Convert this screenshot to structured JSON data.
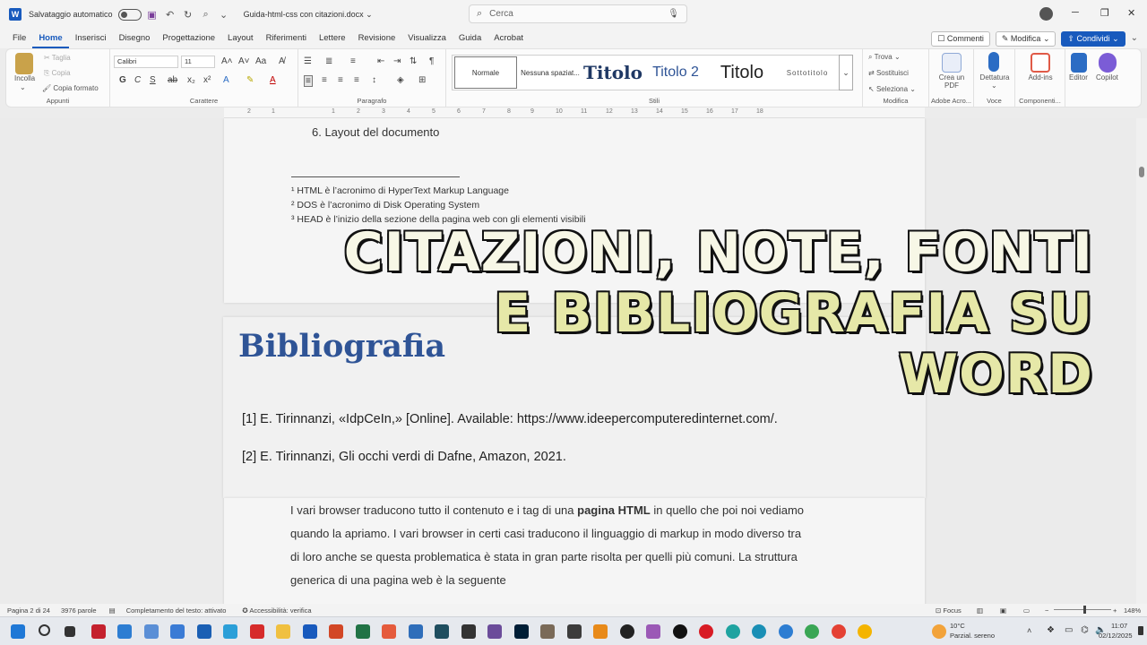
{
  "titlebar": {
    "app_logo": "W",
    "autosave_label": "Salvataggio automatico",
    "doc_title": "Guida-html-css con citazioni.docx",
    "search_placeholder": "Cerca"
  },
  "tabs": [
    "File",
    "Home",
    "Inserisci",
    "Disegno",
    "Progettazione",
    "Layout",
    "Riferimenti",
    "Lettere",
    "Revisione",
    "Visualizza",
    "Guida",
    "Acrobat"
  ],
  "tab_active": "Home",
  "top_buttons": {
    "comments": "Commenti",
    "edit": "Modifica",
    "share": "Condividi"
  },
  "ribbon": {
    "clipboard": {
      "paste": "Incolla",
      "cut": "Taglia",
      "copy": "Copia",
      "format_painter": "Copia formato",
      "label": "Appunti"
    },
    "font": {
      "name": "Calibri",
      "size": "11",
      "label": "Carattere"
    },
    "paragraph": {
      "label": "Paragrafo"
    },
    "styles": {
      "items": [
        "Normale",
        "Nessuna spaziat...",
        "Titolo",
        "Titolo 2",
        "Titolo",
        "Sottotitolo"
      ],
      "label": "Stili"
    },
    "editing": {
      "find": "Trova",
      "replace": "Sostituisci",
      "select": "Seleziona",
      "label": "Modifica"
    },
    "acrobat": {
      "create_pdf": "Crea un PDF",
      "label": "Adobe Acro..."
    },
    "voice": {
      "dictate": "Dettatura",
      "label": "Voce"
    },
    "addins": {
      "addins": "Add-ins",
      "label": "Componenti..."
    },
    "editor": "Editor",
    "copilot": "Copilot"
  },
  "ruler_numbers": [
    "2",
    "1",
    "1",
    "2",
    "3",
    "4",
    "5",
    "6",
    "7",
    "8",
    "9",
    "10",
    "11",
    "12",
    "13",
    "14",
    "15",
    "16",
    "17",
    "18"
  ],
  "document": {
    "list_item": "6.   Layout del documento",
    "footnotes": [
      "¹ HTML è l’acronimo di HyperText Markup Language",
      "² DOS è l’acronimo di Disk Operating System",
      "³ HEAD è l’inizio della sezione della pagina web con gli elementi visibili"
    ],
    "biblio_heading": "Bibliografia",
    "bib_entries": [
      "[1] E. Tirinnanzi, «IdpCeIn,» [Online]. Available: https://www.ideepercomputeredinternet.com/.",
      "[2] E. Tirinnanzi, Gli occhi verdi di Dafne, Amazon, 2021."
    ],
    "body_line1_a": "I vari browser traducono tutto il contenuto e i tag di una ",
    "body_line1_b": "pagina HTML",
    "body_line1_c": " in quello che poi noi vediamo",
    "body_lines": [
      "quando la apriamo. I vari browser in certi casi traducono il linguaggio di markup in modo diverso tra",
      "di loro anche se questa problematica è stata in gran parte risolta per quelli più comuni.  La struttura",
      "generica di una pagina web è la seguente"
    ]
  },
  "overlay": {
    "line1": "CITAZIONI, NOTE, FONTI",
    "line2": "E BIBLIOGRAFIA SU WORD"
  },
  "statusbar": {
    "page": "Pagina 2 di 24",
    "words": "3976 parole",
    "predict": "Completamento del testo: attivato",
    "accessibility": "Accessibilità: verifica",
    "focus": "Focus",
    "zoom": "148%"
  },
  "taskbar": {
    "weather_temp": "10°C",
    "weather_desc": "Parzial. sereno",
    "time": "11:07",
    "date": "02/12/2025"
  },
  "colors": {
    "accent": "#185abd",
    "heading": "#2f5496",
    "overlay_text": "#f7f7e6",
    "overlay_stroke": "#111111"
  }
}
